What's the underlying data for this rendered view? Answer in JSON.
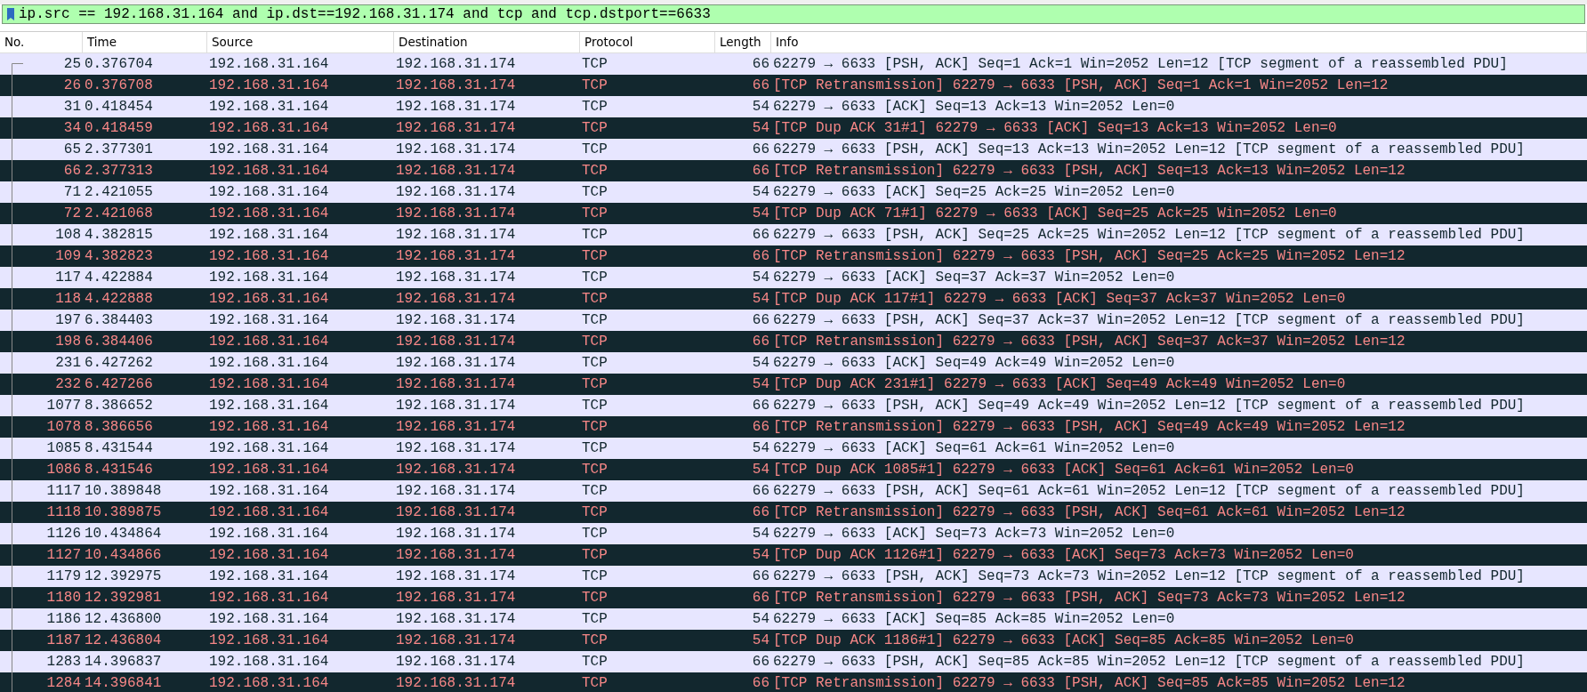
{
  "display_filter": {
    "value": "ip.src == 192.168.31.164 and ip.dst==192.168.31.174 and tcp and tcp.dstport==6633"
  },
  "packet_list": {
    "columns": [
      "No.",
      "Time",
      "Source",
      "Destination",
      "Protocol",
      "Length",
      "Info"
    ],
    "rows": [
      {
        "kind": "normal",
        "cells": [
          "25",
          "0.376704",
          "192.168.31.164",
          "192.168.31.174",
          "TCP",
          "66",
          "62279 → 6633 [PSH, ACK] Seq=1 Ack=1 Win=2052 Len=12 [TCP segment of a reassembled PDU]"
        ]
      },
      {
        "kind": "error",
        "cells": [
          "26",
          "0.376708",
          "192.168.31.164",
          "192.168.31.174",
          "TCP",
          "66",
          "[TCP Retransmission] 62279 → 6633 [PSH, ACK] Seq=1 Ack=1 Win=2052 Len=12"
        ]
      },
      {
        "kind": "normal",
        "cells": [
          "31",
          "0.418454",
          "192.168.31.164",
          "192.168.31.174",
          "TCP",
          "54",
          "62279 → 6633 [ACK] Seq=13 Ack=13 Win=2052 Len=0"
        ]
      },
      {
        "kind": "error",
        "cells": [
          "34",
          "0.418459",
          "192.168.31.164",
          "192.168.31.174",
          "TCP",
          "54",
          "[TCP Dup ACK 31#1] 62279 → 6633 [ACK] Seq=13 Ack=13 Win=2052 Len=0"
        ]
      },
      {
        "kind": "normal",
        "cells": [
          "65",
          "2.377301",
          "192.168.31.164",
          "192.168.31.174",
          "TCP",
          "66",
          "62279 → 6633 [PSH, ACK] Seq=13 Ack=13 Win=2052 Len=12 [TCP segment of a reassembled PDU]"
        ]
      },
      {
        "kind": "error",
        "cells": [
          "66",
          "2.377313",
          "192.168.31.164",
          "192.168.31.174",
          "TCP",
          "66",
          "[TCP Retransmission] 62279 → 6633 [PSH, ACK] Seq=13 Ack=13 Win=2052 Len=12"
        ]
      },
      {
        "kind": "normal",
        "cells": [
          "71",
          "2.421055",
          "192.168.31.164",
          "192.168.31.174",
          "TCP",
          "54",
          "62279 → 6633 [ACK] Seq=25 Ack=25 Win=2052 Len=0"
        ]
      },
      {
        "kind": "error",
        "cells": [
          "72",
          "2.421068",
          "192.168.31.164",
          "192.168.31.174",
          "TCP",
          "54",
          "[TCP Dup ACK 71#1] 62279 → 6633 [ACK] Seq=25 Ack=25 Win=2052 Len=0"
        ]
      },
      {
        "kind": "normal",
        "cells": [
          "108",
          "4.382815",
          "192.168.31.164",
          "192.168.31.174",
          "TCP",
          "66",
          "62279 → 6633 [PSH, ACK] Seq=25 Ack=25 Win=2052 Len=12 [TCP segment of a reassembled PDU]"
        ]
      },
      {
        "kind": "error",
        "cells": [
          "109",
          "4.382823",
          "192.168.31.164",
          "192.168.31.174",
          "TCP",
          "66",
          "[TCP Retransmission] 62279 → 6633 [PSH, ACK] Seq=25 Ack=25 Win=2052 Len=12"
        ]
      },
      {
        "kind": "normal",
        "cells": [
          "117",
          "4.422884",
          "192.168.31.164",
          "192.168.31.174",
          "TCP",
          "54",
          "62279 → 6633 [ACK] Seq=37 Ack=37 Win=2052 Len=0"
        ]
      },
      {
        "kind": "error",
        "cells": [
          "118",
          "4.422888",
          "192.168.31.164",
          "192.168.31.174",
          "TCP",
          "54",
          "[TCP Dup ACK 117#1] 62279 → 6633 [ACK] Seq=37 Ack=37 Win=2052 Len=0"
        ]
      },
      {
        "kind": "normal",
        "cells": [
          "197",
          "6.384403",
          "192.168.31.164",
          "192.168.31.174",
          "TCP",
          "66",
          "62279 → 6633 [PSH, ACK] Seq=37 Ack=37 Win=2052 Len=12 [TCP segment of a reassembled PDU]"
        ]
      },
      {
        "kind": "error",
        "cells": [
          "198",
          "6.384406",
          "192.168.31.164",
          "192.168.31.174",
          "TCP",
          "66",
          "[TCP Retransmission] 62279 → 6633 [PSH, ACK] Seq=37 Ack=37 Win=2052 Len=12"
        ]
      },
      {
        "kind": "normal",
        "cells": [
          "231",
          "6.427262",
          "192.168.31.164",
          "192.168.31.174",
          "TCP",
          "54",
          "62279 → 6633 [ACK] Seq=49 Ack=49 Win=2052 Len=0"
        ]
      },
      {
        "kind": "error",
        "cells": [
          "232",
          "6.427266",
          "192.168.31.164",
          "192.168.31.174",
          "TCP",
          "54",
          "[TCP Dup ACK 231#1] 62279 → 6633 [ACK] Seq=49 Ack=49 Win=2052 Len=0"
        ]
      },
      {
        "kind": "normal",
        "cells": [
          "1077",
          "8.386652",
          "192.168.31.164",
          "192.168.31.174",
          "TCP",
          "66",
          "62279 → 6633 [PSH, ACK] Seq=49 Ack=49 Win=2052 Len=12 [TCP segment of a reassembled PDU]"
        ]
      },
      {
        "kind": "error",
        "cells": [
          "1078",
          "8.386656",
          "192.168.31.164",
          "192.168.31.174",
          "TCP",
          "66",
          "[TCP Retransmission] 62279 → 6633 [PSH, ACK] Seq=49 Ack=49 Win=2052 Len=12"
        ]
      },
      {
        "kind": "normal",
        "cells": [
          "1085",
          "8.431544",
          "192.168.31.164",
          "192.168.31.174",
          "TCP",
          "54",
          "62279 → 6633 [ACK] Seq=61 Ack=61 Win=2052 Len=0"
        ]
      },
      {
        "kind": "error",
        "cells": [
          "1086",
          "8.431546",
          "192.168.31.164",
          "192.168.31.174",
          "TCP",
          "54",
          "[TCP Dup ACK 1085#1] 62279 → 6633 [ACK] Seq=61 Ack=61 Win=2052 Len=0"
        ]
      },
      {
        "kind": "normal",
        "cells": [
          "1117",
          "10.389848",
          "192.168.31.164",
          "192.168.31.174",
          "TCP",
          "66",
          "62279 → 6633 [PSH, ACK] Seq=61 Ack=61 Win=2052 Len=12 [TCP segment of a reassembled PDU]"
        ]
      },
      {
        "kind": "error",
        "cells": [
          "1118",
          "10.389875",
          "192.168.31.164",
          "192.168.31.174",
          "TCP",
          "66",
          "[TCP Retransmission] 62279 → 6633 [PSH, ACK] Seq=61 Ack=61 Win=2052 Len=12"
        ]
      },
      {
        "kind": "normal",
        "cells": [
          "1126",
          "10.434864",
          "192.168.31.164",
          "192.168.31.174",
          "TCP",
          "54",
          "62279 → 6633 [ACK] Seq=73 Ack=73 Win=2052 Len=0"
        ]
      },
      {
        "kind": "error",
        "cells": [
          "1127",
          "10.434866",
          "192.168.31.164",
          "192.168.31.174",
          "TCP",
          "54",
          "[TCP Dup ACK 1126#1] 62279 → 6633 [ACK] Seq=73 Ack=73 Win=2052 Len=0"
        ]
      },
      {
        "kind": "normal",
        "cells": [
          "1179",
          "12.392975",
          "192.168.31.164",
          "192.168.31.174",
          "TCP",
          "66",
          "62279 → 6633 [PSH, ACK] Seq=73 Ack=73 Win=2052 Len=12 [TCP segment of a reassembled PDU]"
        ]
      },
      {
        "kind": "error",
        "cells": [
          "1180",
          "12.392981",
          "192.168.31.164",
          "192.168.31.174",
          "TCP",
          "66",
          "[TCP Retransmission] 62279 → 6633 [PSH, ACK] Seq=73 Ack=73 Win=2052 Len=12"
        ]
      },
      {
        "kind": "normal",
        "cells": [
          "1186",
          "12.436800",
          "192.168.31.164",
          "192.168.31.174",
          "TCP",
          "54",
          "62279 → 6633 [ACK] Seq=85 Ack=85 Win=2052 Len=0"
        ]
      },
      {
        "kind": "error",
        "cells": [
          "1187",
          "12.436804",
          "192.168.31.164",
          "192.168.31.174",
          "TCP",
          "54",
          "[TCP Dup ACK 1186#1] 62279 → 6633 [ACK] Seq=85 Ack=85 Win=2052 Len=0"
        ]
      },
      {
        "kind": "normal",
        "cells": [
          "1283",
          "14.396837",
          "192.168.31.164",
          "192.168.31.174",
          "TCP",
          "66",
          "62279 → 6633 [PSH, ACK] Seq=85 Ack=85 Win=2052 Len=12 [TCP segment of a reassembled PDU]"
        ]
      },
      {
        "kind": "error",
        "cells": [
          "1284",
          "14.396841",
          "192.168.31.164",
          "192.168.31.174",
          "TCP",
          "66",
          "[TCP Retransmission] 62279 → 6633 [PSH, ACK] Seq=85 Ack=85 Win=2052 Len=12"
        ]
      }
    ]
  }
}
